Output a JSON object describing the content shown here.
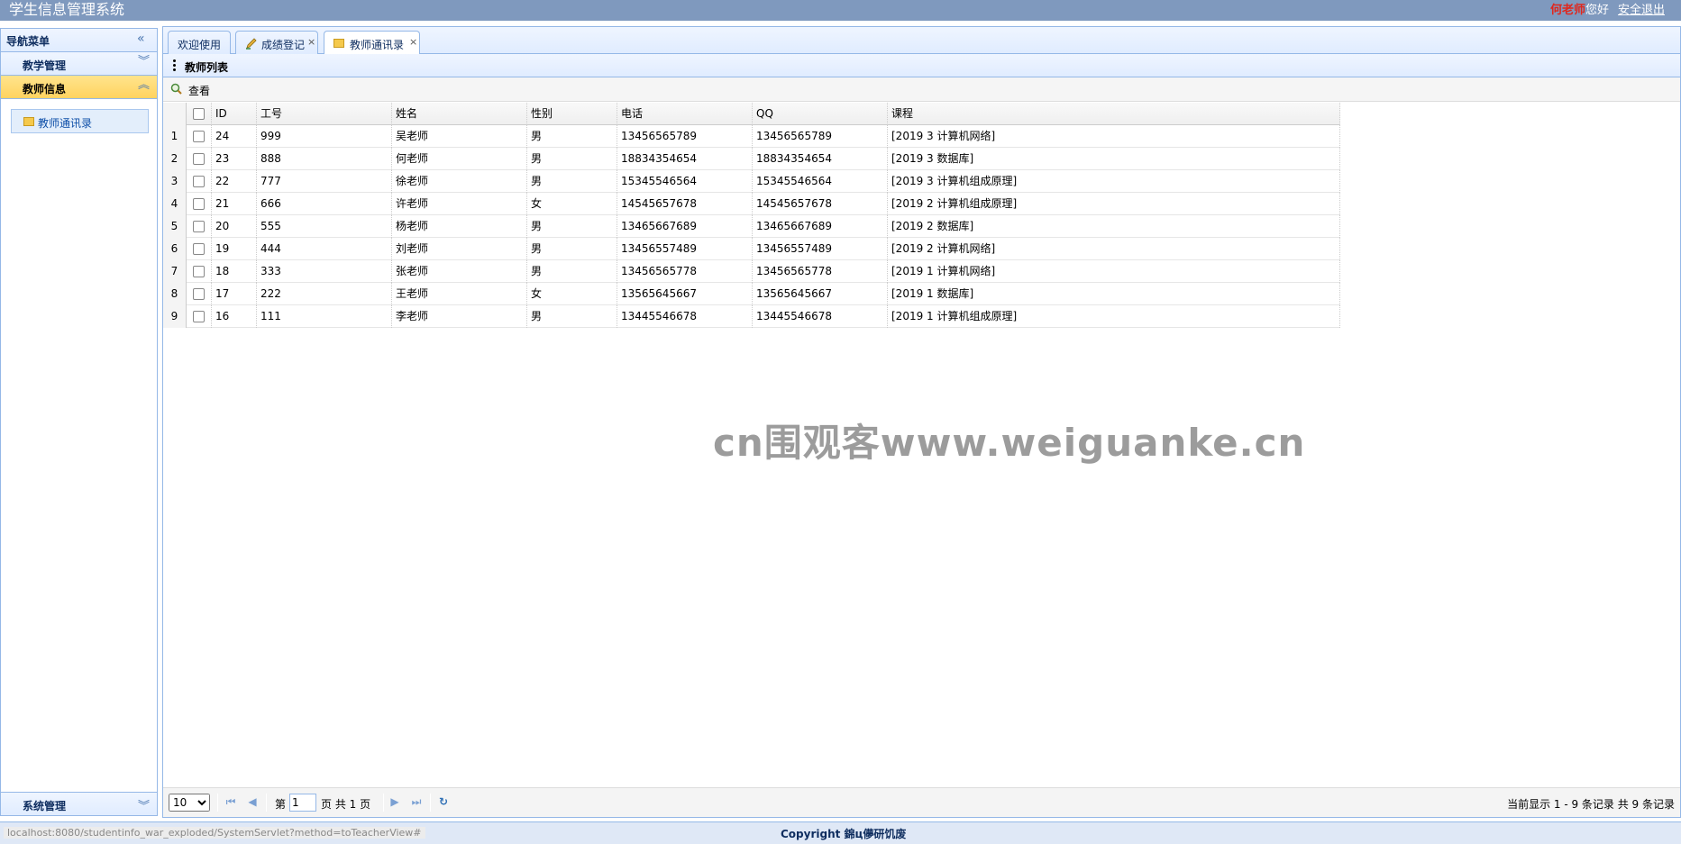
{
  "header": {
    "app_title": "学生信息管理系统",
    "user_name": "何老师",
    "greeting": "您好",
    "logout_label": "安全退出"
  },
  "nav": {
    "title": "导航菜单",
    "sections": [
      {
        "label": "教学管理"
      },
      {
        "label": "教师信息"
      }
    ],
    "active_item": "教师通讯录",
    "bottom_section": "系统管理"
  },
  "tabs": [
    {
      "label": "欢迎使用",
      "closable": false
    },
    {
      "label": "成绩登记",
      "closable": true
    },
    {
      "label": "教师通讯录",
      "closable": true
    }
  ],
  "tab_close_glyph": "×",
  "panel": {
    "title": "教师列表",
    "toolbar_view_label": "查看"
  },
  "grid": {
    "columns": [
      "ID",
      "工号",
      "姓名",
      "性别",
      "电话",
      "QQ",
      "课程"
    ],
    "rows": [
      {
        "rn": "1",
        "id": "24",
        "no": "999",
        "name": "吴老师",
        "sex": "男",
        "tel": "13456565789",
        "qq": "13456565789",
        "course": "[2019 3 计算机网络]"
      },
      {
        "rn": "2",
        "id": "23",
        "no": "888",
        "name": "何老师",
        "sex": "男",
        "tel": "18834354654",
        "qq": "18834354654",
        "course": "[2019 3 数据库]"
      },
      {
        "rn": "3",
        "id": "22",
        "no": "777",
        "name": "徐老师",
        "sex": "男",
        "tel": "15345546564",
        "qq": "15345546564",
        "course": "[2019 3 计算机组成原理]"
      },
      {
        "rn": "4",
        "id": "21",
        "no": "666",
        "name": "许老师",
        "sex": "女",
        "tel": "14545657678",
        "qq": "14545657678",
        "course": "[2019 2 计算机组成原理]"
      },
      {
        "rn": "5",
        "id": "20",
        "no": "555",
        "name": "杨老师",
        "sex": "男",
        "tel": "13465667689",
        "qq": "13465667689",
        "course": "[2019 2 数据库]"
      },
      {
        "rn": "6",
        "id": "19",
        "no": "444",
        "name": "刘老师",
        "sex": "男",
        "tel": "13456557489",
        "qq": "13456557489",
        "course": "[2019 2 计算机网络]"
      },
      {
        "rn": "7",
        "id": "18",
        "no": "333",
        "name": "张老师",
        "sex": "男",
        "tel": "13456565778",
        "qq": "13456565778",
        "course": "[2019 1 计算机网络]"
      },
      {
        "rn": "8",
        "id": "17",
        "no": "222",
        "name": "王老师",
        "sex": "女",
        "tel": "13565645667",
        "qq": "13565645667",
        "course": "[2019 1 数据库]"
      },
      {
        "rn": "9",
        "id": "16",
        "no": "111",
        "name": "李老师",
        "sex": "男",
        "tel": "13445546678",
        "qq": "13445546678",
        "course": "[2019 1 计算机组成原理]"
      }
    ]
  },
  "watermark": "cn围观客www.weiguanke.cn",
  "pager": {
    "page_size": "10",
    "page_prefix": "第",
    "page_value": "1",
    "page_suffix": "页 共 1 页",
    "info": "当前显示 1 - 9 条记录 共 9 条记录"
  },
  "footer": {
    "status_url": "localhost:8080/studentinfo_war_exploded/SystemServlet?method=toTeacherView#",
    "copyright": "Copyright 錦ц儚研饥废"
  },
  "colors": {
    "header_bg": "#7f99be",
    "accent_border": "#95b8e7",
    "active_section": "#ffd35f",
    "user_name": "#e0261c"
  }
}
